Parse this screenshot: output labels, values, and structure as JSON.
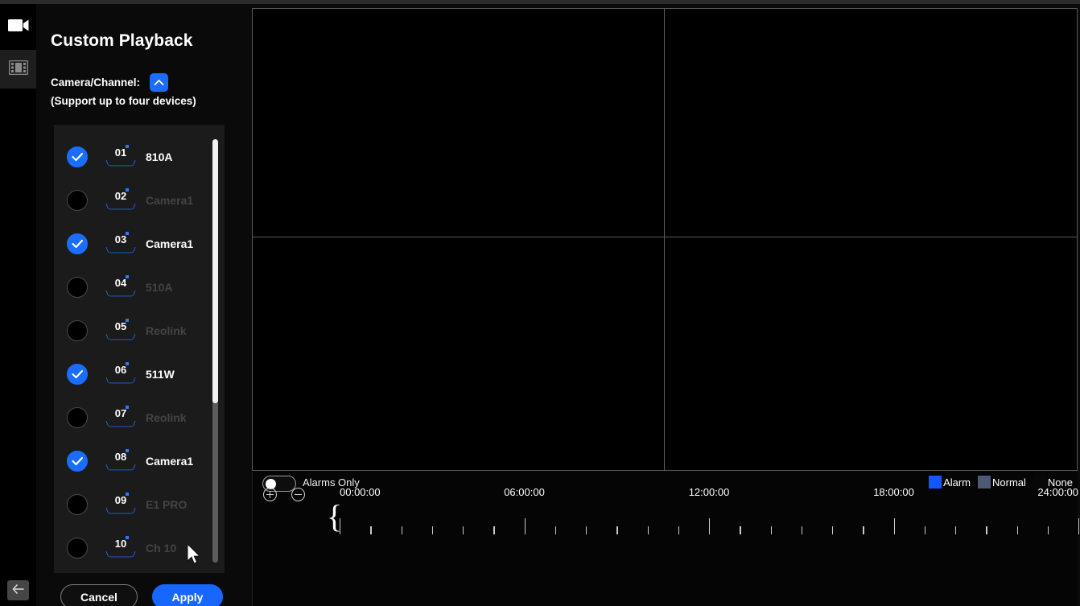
{
  "window": {
    "background": "#0a0a0a",
    "accent": "#1a6dff"
  },
  "rail": {
    "items": [
      {
        "name": "camera-icon",
        "label": "Live View"
      },
      {
        "name": "film-icon",
        "label": "Playback"
      }
    ],
    "back_label": "Back"
  },
  "panel": {
    "title": "Custom Playback",
    "camera_channel_label": "Camera/Channel:",
    "collapse_icon": "chevron-up-icon",
    "support_note": "(Support up to four devices)",
    "cancel_label": "Cancel",
    "apply_label": "Apply"
  },
  "cameras": [
    {
      "num": "01",
      "name": "810A",
      "selected": true
    },
    {
      "num": "02",
      "name": "Camera1",
      "selected": false
    },
    {
      "num": "03",
      "name": "Camera1",
      "selected": true
    },
    {
      "num": "04",
      "name": "510A",
      "selected": false
    },
    {
      "num": "05",
      "name": "Reolink",
      "selected": false
    },
    {
      "num": "06",
      "name": "511W",
      "selected": true
    },
    {
      "num": "07",
      "name": "Reolink",
      "selected": false
    },
    {
      "num": "08",
      "name": "Camera1",
      "selected": true
    },
    {
      "num": "09",
      "name": "E1 PRO",
      "selected": false
    },
    {
      "num": "10",
      "name": "Ch 10",
      "selected": false
    }
  ],
  "video_grid": {
    "rows": 2,
    "cols": 2,
    "panes": [
      "",
      "",
      "",
      ""
    ]
  },
  "timeline": {
    "alarms_only_label": "Alarms Only",
    "alarms_only_on": false,
    "zoom_in_icon": "plus-circle-icon",
    "zoom_out_icon": "minus-circle-icon",
    "legend": [
      {
        "label": "Alarm",
        "color": "#1456ff"
      },
      {
        "label": "Normal",
        "color": "#4d5a75"
      },
      {
        "label": "None",
        "color": "#070707"
      }
    ],
    "labels": [
      "00:00:00",
      "06:00:00",
      "12:00:00",
      "18:00:00",
      "24:00:00"
    ],
    "hours_total": 24,
    "start_brace": "{",
    "end_brace": "}"
  }
}
